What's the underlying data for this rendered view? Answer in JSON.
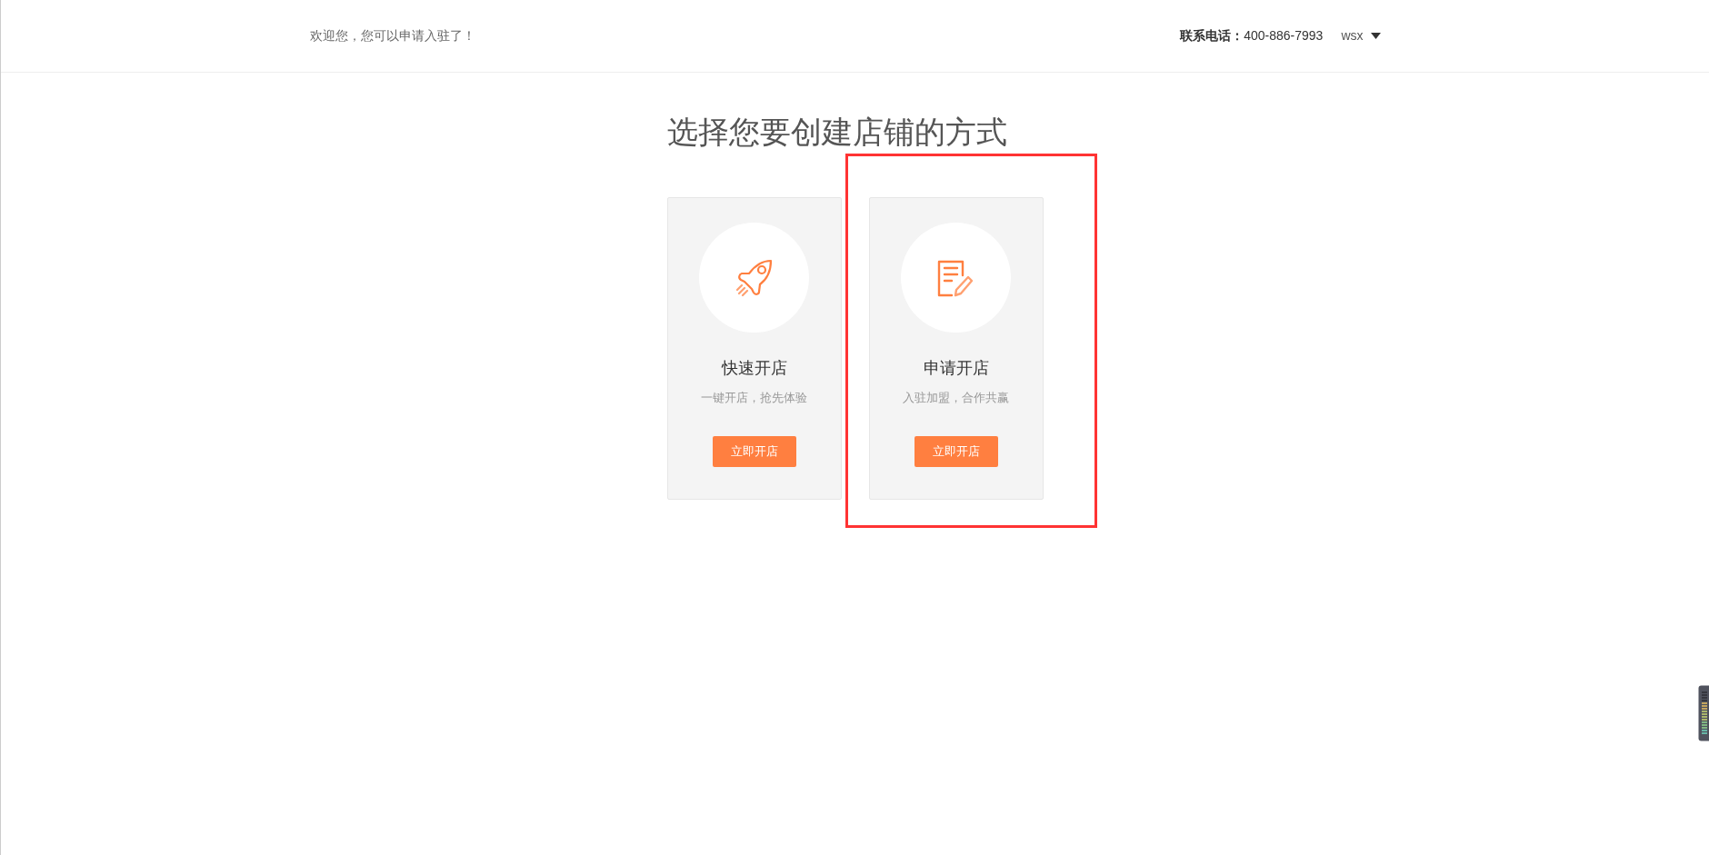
{
  "header": {
    "welcome": "欢迎您，您可以申请入驻了！",
    "phone_label": "联系电话：",
    "phone": "400-886-7993",
    "user": "wsx"
  },
  "title": "选择您要创建店铺的方式",
  "cards": [
    {
      "kind": "rocket",
      "title": "快速开店",
      "subtitle": "一键开店，抢先体验",
      "button": "立即开店",
      "highlighted": false
    },
    {
      "kind": "form",
      "title": "申请开店",
      "subtitle": "入驻加盟，合作共赢",
      "button": "立即开店",
      "highlighted": true
    }
  ]
}
